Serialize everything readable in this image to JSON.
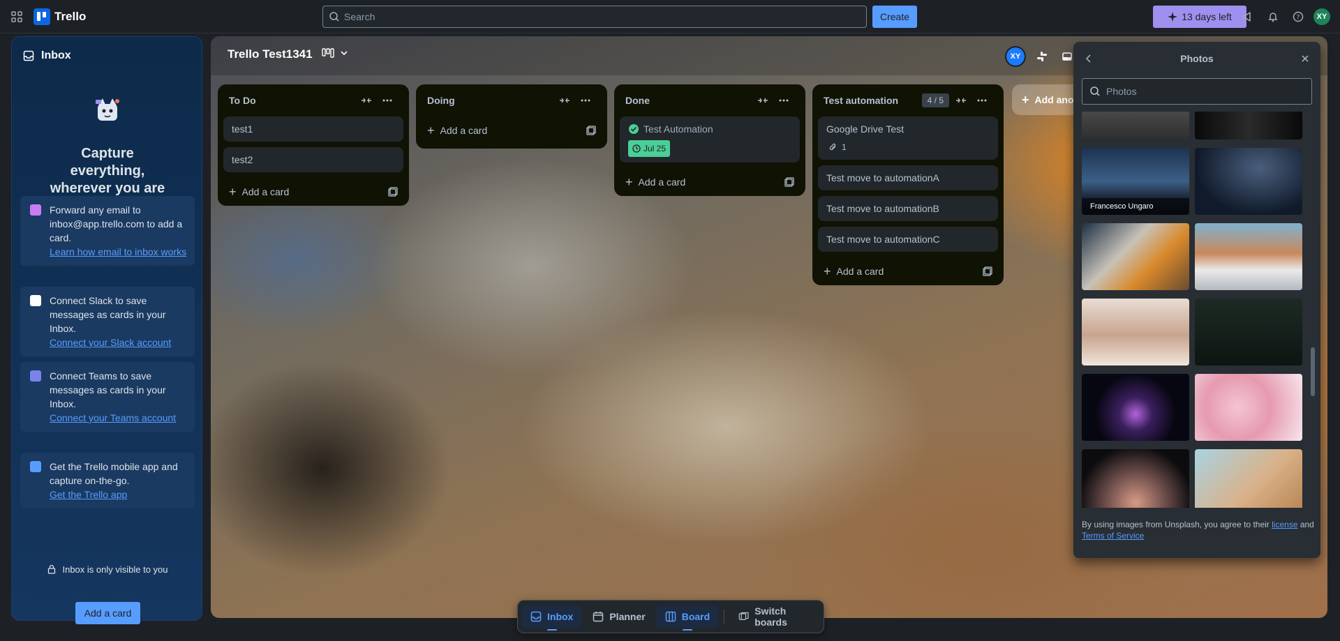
{
  "topbar": {
    "app_name": "Trello",
    "search_placeholder": "Search",
    "create_label": "Create",
    "trial_label": "13 days left",
    "user_initials": "XY"
  },
  "inbox": {
    "title": "Inbox",
    "headline": "Capture everything, wherever you are",
    "cards": [
      {
        "text": "Forward any email to inbox@app.trello.com to add a card.",
        "link": "Learn how email to inbox works"
      },
      {
        "text": "Connect Slack to save messages as cards in your Inbox.",
        "link": "Connect your Slack account"
      },
      {
        "text": "Connect Teams to save messages as cards in your Inbox.",
        "link": "Connect your Teams account"
      },
      {
        "text": "Get the Trello mobile app and capture on-the-go.",
        "link": "Get the Trello app"
      }
    ],
    "privacy_note": "Inbox is only visible to you",
    "add_card_label": "Add a card"
  },
  "board": {
    "title": "Trello Test1341",
    "member_initials": "XY",
    "add_list_label": "Add another list",
    "lists": [
      {
        "name": "To Do",
        "cards": [
          {
            "title": "test1"
          },
          {
            "title": "test2"
          }
        ],
        "add_label": "Add a card"
      },
      {
        "name": "Doing",
        "cards": [],
        "add_label": "Add a card"
      },
      {
        "name": "Done",
        "cards": [
          {
            "title": "Test Automation",
            "date": "Jul 25"
          }
        ],
        "add_label": "Add a card"
      },
      {
        "name": "Test automation",
        "wip": "4 / 5",
        "cards": [
          {
            "title": "Google Drive Test",
            "attachments": "1"
          },
          {
            "title": "Test move to automationA"
          },
          {
            "title": "Test move to automationB"
          },
          {
            "title": "Test move to automationC"
          }
        ],
        "add_label": "Add a card"
      }
    ]
  },
  "photos": {
    "title": "Photos",
    "search_placeholder": "Photos",
    "thumb_credit": "Francesco Ungaro",
    "footer_prefix": "By using images from Unsplash, you agree to their ",
    "footer_license": "license",
    "footer_and": " and ",
    "footer_terms": "Terms of Service"
  },
  "switcher": {
    "inbox": "Inbox",
    "planner": "Planner",
    "board": "Board",
    "switch": "Switch boards"
  },
  "colors": {
    "accent": "#579dff",
    "trial": "#9f8fef",
    "list_bg": "#101204",
    "card_bg": "#22272b",
    "date_badge": "#4bce97"
  }
}
